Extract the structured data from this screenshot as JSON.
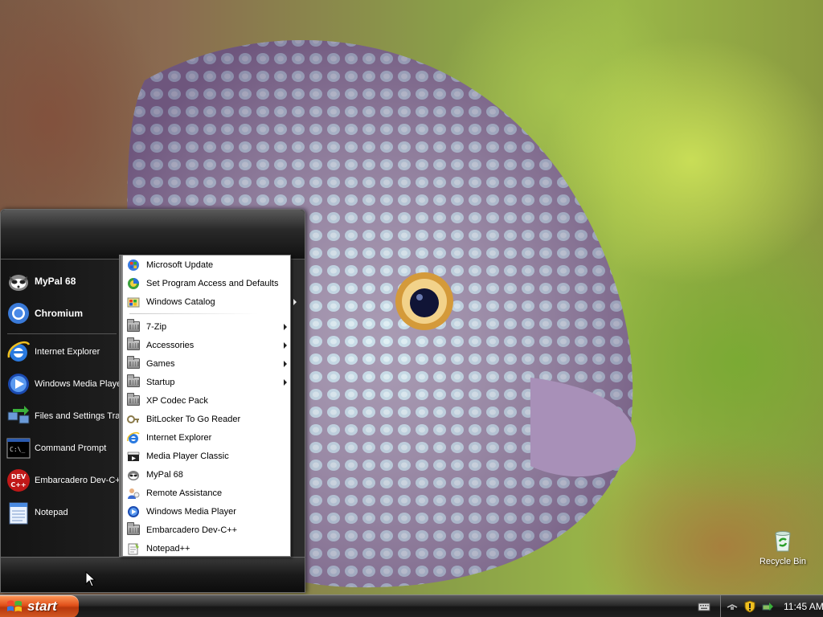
{
  "desktop": {
    "recycle_bin_label": "Recycle Bin"
  },
  "start_menu": {
    "pinned": [
      {
        "label": "MyPal 68",
        "icon": "mypal-icon"
      },
      {
        "label": "Chromium",
        "icon": "chromium-icon"
      }
    ],
    "recent": [
      {
        "label": "Internet Explorer",
        "icon": "internet-explorer-icon"
      },
      {
        "label": "Windows Media Player",
        "icon": "windows-media-player-icon"
      },
      {
        "label": "Files and Settings Transfer Wizard",
        "icon": "transfer-wizard-icon"
      },
      {
        "label": "Command Prompt",
        "icon": "command-prompt-icon"
      },
      {
        "label": "Embarcadero Dev-C++",
        "icon": "devcpp-icon"
      },
      {
        "label": "Notepad",
        "icon": "notepad-icon"
      }
    ]
  },
  "all_programs": {
    "top_items": [
      {
        "label": "Microsoft Update",
        "icon": "microsoft-update-icon"
      },
      {
        "label": "Set Program Access and Defaults",
        "icon": "program-access-icon"
      },
      {
        "label": "Windows Catalog",
        "icon": "windows-catalog-icon"
      }
    ],
    "items": [
      {
        "label": "7-Zip",
        "icon": "folder-icon",
        "submenu": true
      },
      {
        "label": "Accessories",
        "icon": "folder-icon",
        "submenu": true
      },
      {
        "label": "Games",
        "icon": "folder-icon",
        "submenu": true
      },
      {
        "label": "Startup",
        "icon": "folder-icon",
        "submenu": true
      },
      {
        "label": "XP Codec Pack",
        "icon": "folder-icon",
        "submenu": false
      },
      {
        "label": "BitLocker To Go Reader",
        "icon": "bitlocker-icon",
        "submenu": false
      },
      {
        "label": "Internet Explorer",
        "icon": "internet-explorer-icon",
        "submenu": false
      },
      {
        "label": "Media Player Classic",
        "icon": "media-player-classic-icon",
        "submenu": false
      },
      {
        "label": "MyPal 68",
        "icon": "mypal-icon",
        "submenu": false
      },
      {
        "label": "Remote Assistance",
        "icon": "remote-assistance-icon",
        "submenu": false
      },
      {
        "label": "Windows Media Player",
        "icon": "windows-media-player-icon",
        "submenu": false
      },
      {
        "label": "Embarcadero Dev-C++",
        "icon": "folder-icon",
        "submenu": false
      },
      {
        "label": "Notepad++",
        "icon": "notepadpp-icon",
        "submenu": false
      }
    ]
  },
  "taskbar": {
    "start_label": "start",
    "clock": "11:45 AM"
  },
  "colors": {
    "start_button": "#e0501a",
    "taskbar": "#222222",
    "menu_dark": "#1b1b1b"
  }
}
